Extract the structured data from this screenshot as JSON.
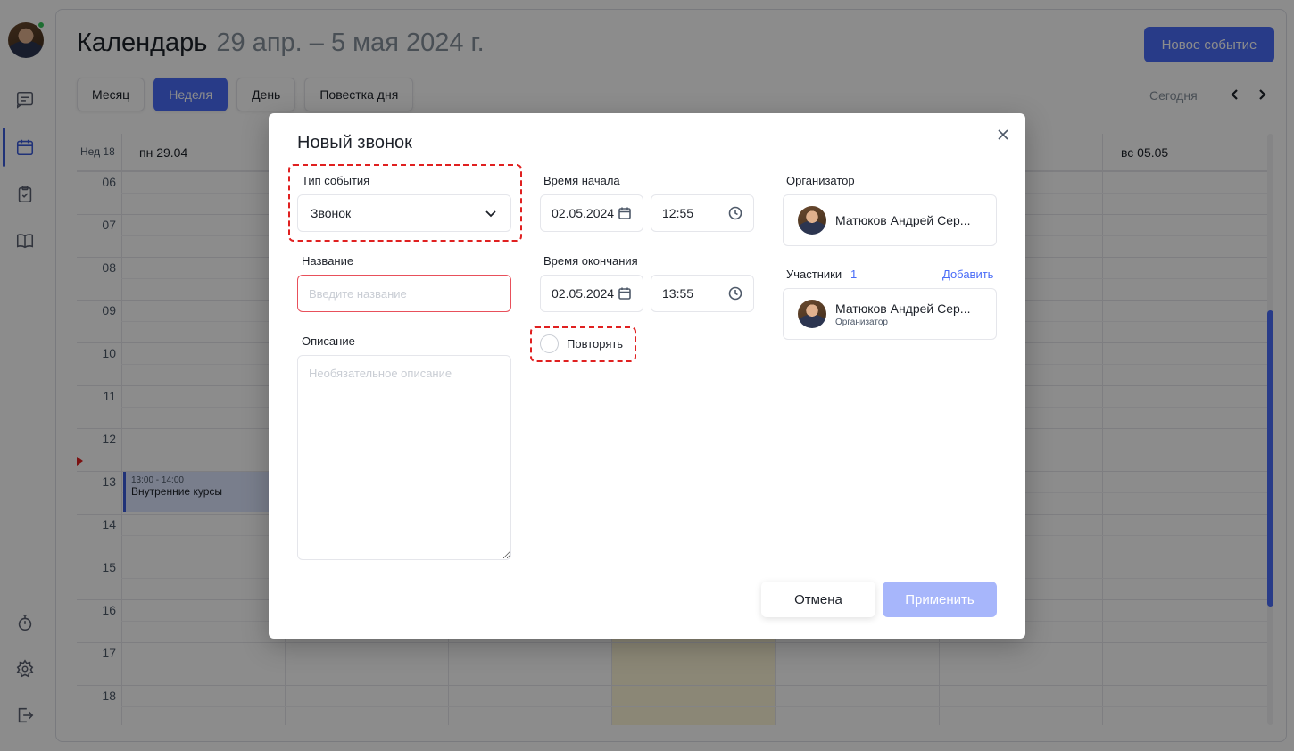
{
  "sidebar": {
    "nav": [
      {
        "name": "messages-icon"
      },
      {
        "name": "calendar-icon",
        "active": true
      },
      {
        "name": "tasks-icon"
      },
      {
        "name": "book-icon"
      },
      {
        "name": "timer-icon"
      },
      {
        "name": "settings-icon"
      },
      {
        "name": "logout-icon"
      }
    ]
  },
  "header": {
    "title": "Календарь",
    "range": "29 апр. – 5 мая 2024 г.",
    "new_event_label": "Новое событие"
  },
  "views": {
    "tabs": [
      "Месяц",
      "Неделя",
      "День",
      "Повестка дня"
    ],
    "active": "Неделя",
    "today_label": "Сегодня"
  },
  "calendar": {
    "week_label": "Нед 18",
    "days": [
      "пн 29.04",
      "вс 05.05"
    ],
    "hours": [
      "06",
      "07",
      "08",
      "09",
      "10",
      "11",
      "12",
      "13",
      "14",
      "15",
      "16",
      "17",
      "18"
    ],
    "event": {
      "time": "13:00 - 14:00",
      "title": "Внутренние курсы"
    }
  },
  "modal": {
    "title": "Новый звонок",
    "event_type": {
      "label": "Тип события",
      "value": "Звонок"
    },
    "name": {
      "label": "Название",
      "placeholder": "Введите название"
    },
    "description": {
      "label": "Описание",
      "placeholder": "Необязательное описание"
    },
    "start": {
      "label": "Время начала",
      "date": "02.05.2024",
      "time": "12:55"
    },
    "end": {
      "label": "Время окончания",
      "date": "02.05.2024",
      "time": "13:55"
    },
    "repeat": {
      "label": "Повторять",
      "checked": false
    },
    "organizer": {
      "label": "Организатор",
      "name": "Матюков Андрей Сер..."
    },
    "participants": {
      "label": "Участники",
      "count": "1",
      "add_label": "Добавить",
      "items": [
        {
          "name": "Матюков Андрей Сер...",
          "role": "Организатор"
        }
      ]
    },
    "cancel_label": "Отмена",
    "apply_label": "Применить"
  },
  "colors": {
    "accent": "#4a6cf7",
    "error": "#e8505b",
    "highlight": "#e02020"
  }
}
